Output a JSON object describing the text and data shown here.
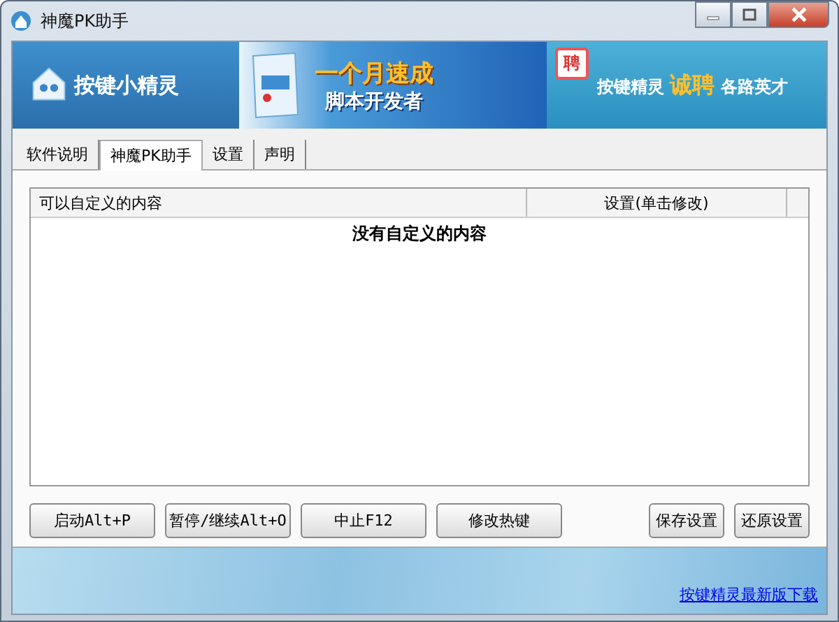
{
  "window": {
    "title": "神魔PK助手"
  },
  "banner": {
    "logo_text": "按键小精灵",
    "ad_headline": "一个月速成",
    "ad_subline": "脚本开发者",
    "ad_badge": "聘",
    "recruit_prefix": "按键精灵",
    "recruit_highlight": "诚聘",
    "recruit_suffix": "各路英才"
  },
  "tabs": [
    {
      "label": "软件说明",
      "selected": false
    },
    {
      "label": "神魔PK助手",
      "selected": true
    },
    {
      "label": "设置",
      "selected": false
    },
    {
      "label": "声明",
      "selected": false
    }
  ],
  "table": {
    "columns": [
      "可以自定义的内容",
      "设置(单击修改)"
    ],
    "empty_message": "没有自定义的内容"
  },
  "buttons_left": [
    "启动Alt+P",
    "暂停/继续Alt+O",
    "中止F12",
    "修改热键"
  ],
  "buttons_right": [
    "保存设置",
    "还原设置"
  ],
  "footer_link": "按键精灵最新版下载"
}
